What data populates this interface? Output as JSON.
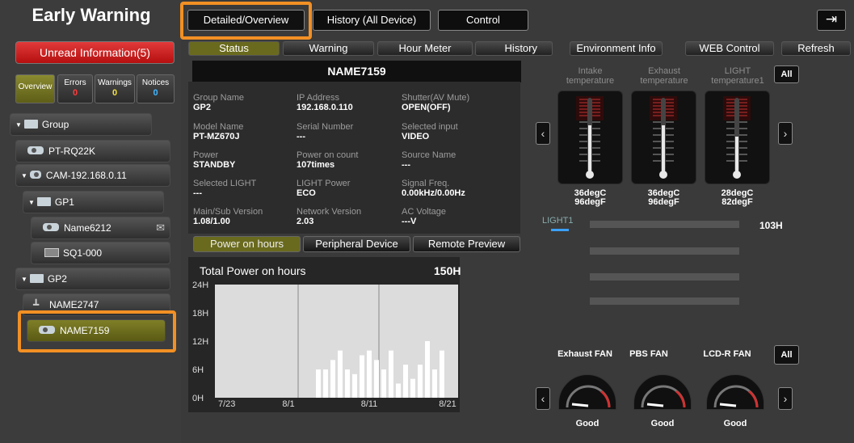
{
  "sidebar": {
    "title": "Early Warning",
    "unread": "Unread Information(5)",
    "tabs": [
      {
        "label": "Overview"
      },
      {
        "label": "Errors",
        "count": "0"
      },
      {
        "label": "Warnings",
        "count": "0"
      },
      {
        "label": "Notices",
        "count": "0"
      }
    ],
    "tree": [
      {
        "label": "Group"
      },
      {
        "label": "PT-RQ22K"
      },
      {
        "label": "CAM-192.168.0.11"
      },
      {
        "label": "GP1"
      },
      {
        "label": "Name6212"
      },
      {
        "label": "SQ1-000"
      },
      {
        "label": "GP2"
      },
      {
        "label": "NAME2747"
      },
      {
        "label": "NAME7159"
      }
    ]
  },
  "topnav": {
    "detailed": "Detailed/Overview",
    "history": "History (All Device)",
    "control": "Control"
  },
  "tabs": {
    "status": "Status",
    "warning": "Warning",
    "hour": "Hour Meter",
    "history": "History",
    "env": "Environment Info",
    "web": "WEB Control",
    "refresh": "Refresh"
  },
  "device": {
    "name": "NAME7159",
    "fields": [
      {
        "label": "Group Name",
        "value": "GP2"
      },
      {
        "label": "IP Address",
        "value": "192.168.0.110"
      },
      {
        "label": "Shutter(AV Mute)",
        "value": "OPEN(OFF)"
      },
      {
        "label": "Model Name",
        "value": "PT-MZ670J"
      },
      {
        "label": "Serial Number",
        "value": "---"
      },
      {
        "label": "Selected input",
        "value": "VIDEO"
      },
      {
        "label": "Power",
        "value": "STANDBY"
      },
      {
        "label": "Power on count",
        "value": "107times"
      },
      {
        "label": "Source Name",
        "value": "---"
      },
      {
        "label": "Selected LIGHT",
        "value": "---"
      },
      {
        "label": "LIGHT Power",
        "value": "ECO"
      },
      {
        "label": "Signal Freq.",
        "value": "0.00kHz/0.00Hz"
      },
      {
        "label": "Main/Sub Version",
        "value": "1.08/1.00"
      },
      {
        "label": "Network Version",
        "value": "2.03"
      },
      {
        "label": "AC Voltage",
        "value": "---V"
      }
    ]
  },
  "subtabs": {
    "power": "Power on hours",
    "periph": "Peripheral Device",
    "remote": "Remote Preview"
  },
  "chart_data": {
    "type": "bar",
    "title": "Total Power on hours",
    "total": "150H",
    "ylim": [
      0,
      24
    ],
    "yticks": [
      "24H",
      "18H",
      "12H",
      "6H",
      "0H"
    ],
    "xticks": [
      "7/23",
      "8/1",
      "8/11",
      "8/21"
    ],
    "values": [
      6,
      6,
      8,
      10,
      6,
      5,
      9,
      10,
      8,
      6,
      10,
      3,
      7,
      4,
      7,
      12,
      6,
      10
    ]
  },
  "environment": {
    "all_label": "All",
    "temps": [
      {
        "label1": "Intake",
        "label2": "temperature",
        "c": "36degC",
        "f": "96degF"
      },
      {
        "label1": "Exhaust",
        "label2": "temperature",
        "c": "36degC",
        "f": "96degF"
      },
      {
        "label1": "LIGHT",
        "label2": "temperature1",
        "c": "28degC",
        "f": "82degF"
      }
    ],
    "light_label": "LIGHT1",
    "light_hours": "103H",
    "fans": [
      {
        "name": "Exhaust FAN",
        "status": "Good"
      },
      {
        "name": "PBS FAN",
        "status": "Good"
      },
      {
        "name": "LCD-R FAN",
        "status": "Good"
      }
    ]
  },
  "colors": {
    "highlight": "#f29024",
    "accent": "#6a6a1e",
    "unread": "#d42525"
  }
}
